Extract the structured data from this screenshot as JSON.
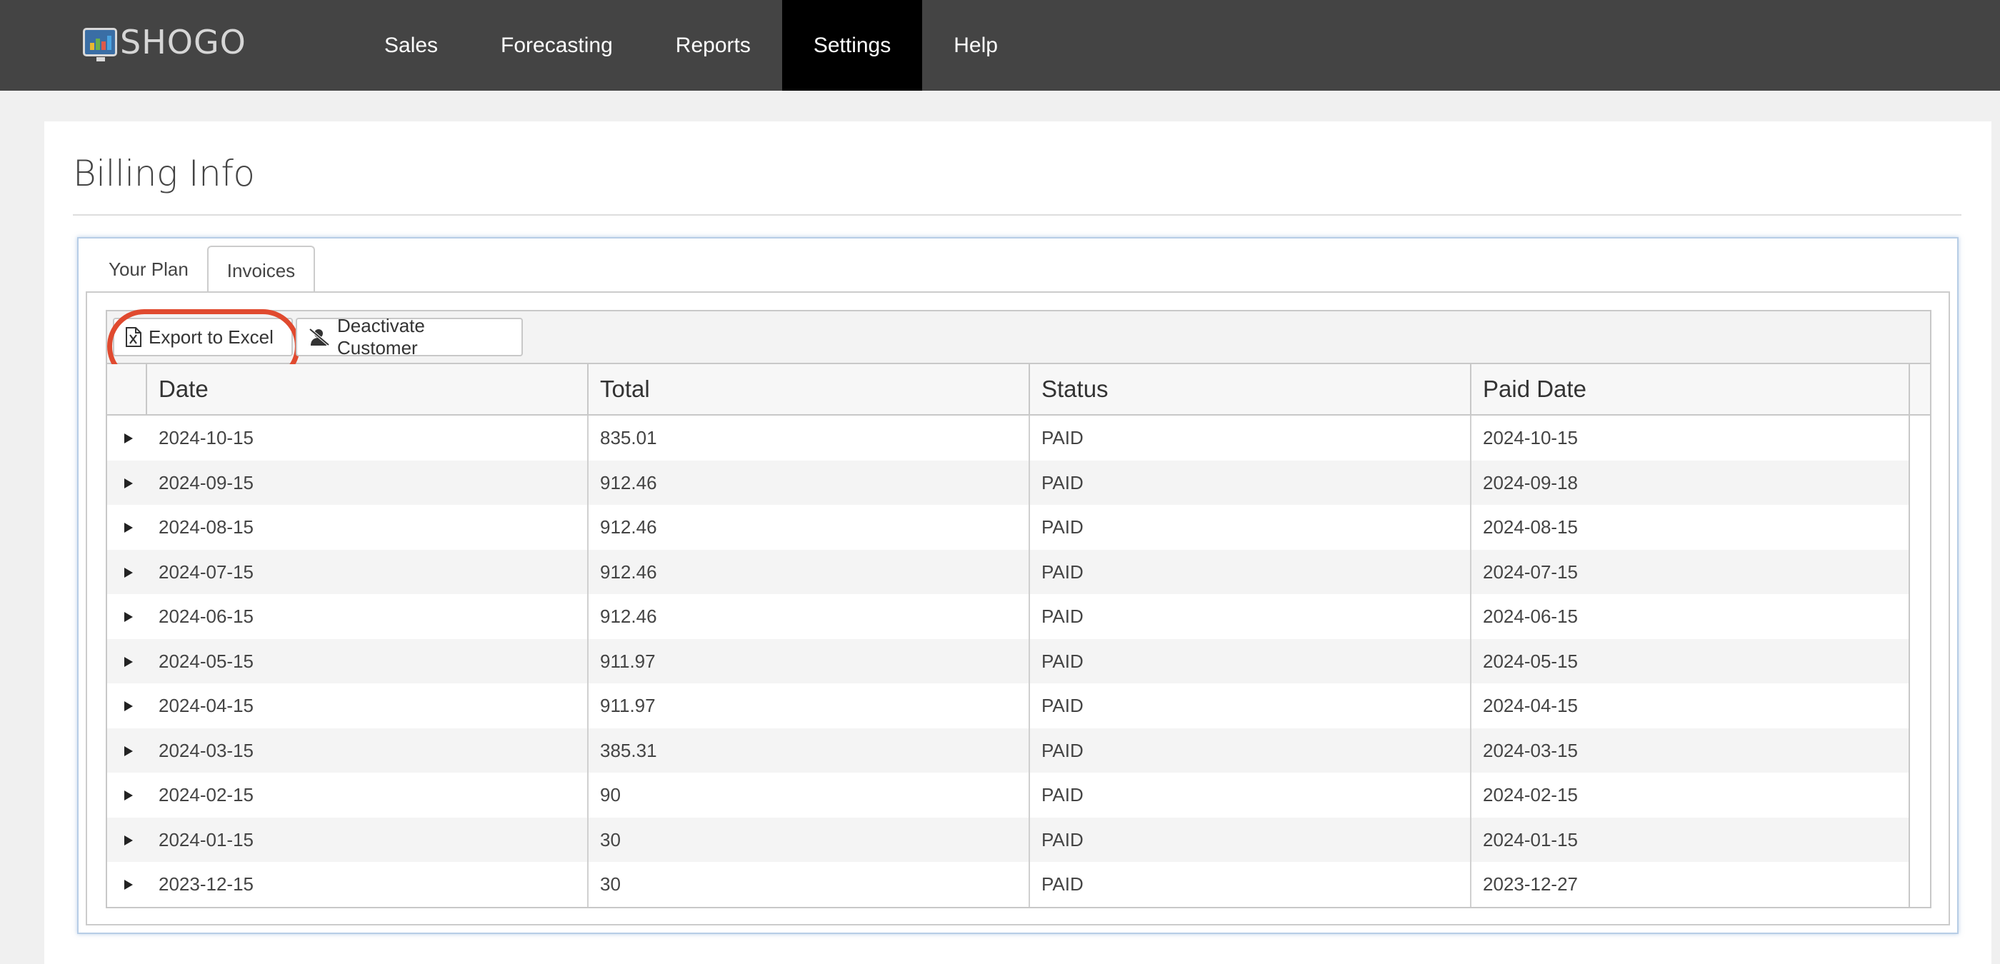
{
  "brand": {
    "name": "SHOGO"
  },
  "nav": {
    "items": [
      {
        "label": "Sales"
      },
      {
        "label": "Forecasting"
      },
      {
        "label": "Reports"
      },
      {
        "label": "Settings",
        "active": true
      },
      {
        "label": "Help"
      }
    ]
  },
  "page": {
    "title": "Billing Info"
  },
  "tabs": [
    {
      "label": "Your Plan"
    },
    {
      "label": "Invoices",
      "active": true
    }
  ],
  "toolbar": {
    "export_label": "Export to Excel",
    "deactivate_label": "Deactivate Customer"
  },
  "columns": [
    "Date",
    "Total",
    "Status",
    "Paid Date"
  ],
  "invoices": [
    {
      "date": "2024-10-15",
      "total": "835.01",
      "status": "PAID",
      "paid_date": "2024-10-15"
    },
    {
      "date": "2024-09-15",
      "total": "912.46",
      "status": "PAID",
      "paid_date": "2024-09-18"
    },
    {
      "date": "2024-08-15",
      "total": "912.46",
      "status": "PAID",
      "paid_date": "2024-08-15"
    },
    {
      "date": "2024-07-15",
      "total": "912.46",
      "status": "PAID",
      "paid_date": "2024-07-15"
    },
    {
      "date": "2024-06-15",
      "total": "912.46",
      "status": "PAID",
      "paid_date": "2024-06-15"
    },
    {
      "date": "2024-05-15",
      "total": "911.97",
      "status": "PAID",
      "paid_date": "2024-05-15"
    },
    {
      "date": "2024-04-15",
      "total": "911.97",
      "status": "PAID",
      "paid_date": "2024-04-15"
    },
    {
      "date": "2024-03-15",
      "total": "385.31",
      "status": "PAID",
      "paid_date": "2024-03-15"
    },
    {
      "date": "2024-02-15",
      "total": "90",
      "status": "PAID",
      "paid_date": "2024-02-15"
    },
    {
      "date": "2024-01-15",
      "total": "30",
      "status": "PAID",
      "paid_date": "2024-01-15"
    },
    {
      "date": "2023-12-15",
      "total": "30",
      "status": "PAID",
      "paid_date": "2023-12-27"
    }
  ],
  "colors": {
    "nav_bg": "#444444",
    "nav_active_bg": "#000000",
    "highlight_ring": "#e04a2f",
    "tab_frame_border": "#b7cde6"
  }
}
